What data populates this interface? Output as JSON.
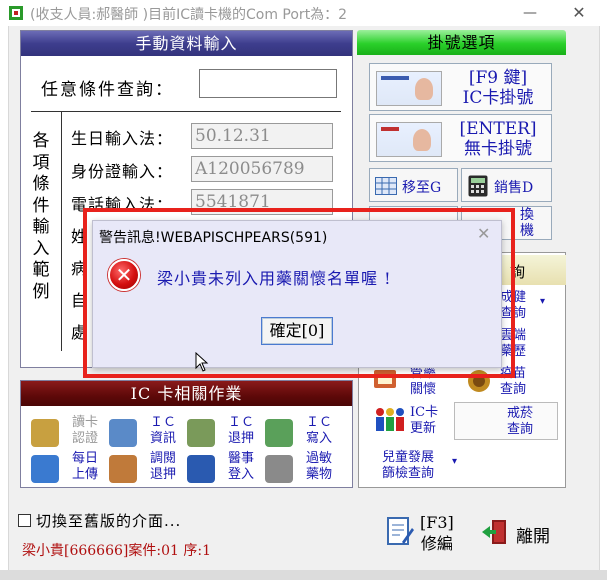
{
  "window": {
    "title": "(收支人員:郝醫師 )目前IC讀卡機的Com Port為：2",
    "minimize_glyph": "—",
    "close_glyph": "✕"
  },
  "manual": {
    "header": "手動資料輸入",
    "query_label": "任意條件查詢：",
    "query_value": "",
    "vertical_label": "各項條件輸入範例",
    "fields": [
      {
        "label": "生日輸入法：",
        "value": "50.12.31"
      },
      {
        "label": "身份證輸入：",
        "value": "A120056789"
      },
      {
        "label": "電話輸入法：",
        "value": "5541871"
      },
      {
        "label": "姓",
        "value": ""
      },
      {
        "label": "病",
        "value": ""
      },
      {
        "label": "自",
        "value": ""
      },
      {
        "label": "處",
        "value": ""
      }
    ]
  },
  "register": {
    "header": "掛號選項",
    "ic_button": {
      "line1": "[F9 鍵]",
      "line2": "IC卡掛號"
    },
    "enter_button": {
      "line1": "[ENTER]",
      "line2": "無卡掛號"
    },
    "goto_button": "移至G",
    "sales_button": "銷售D",
    "switch_line1": "換",
    "switch_line2": "機"
  },
  "query_panel": {
    "header": "詢",
    "items": [
      {
        "l1": "成健",
        "l2": "查詢"
      },
      {
        "l1": "雲端",
        "l2": "藥歷"
      },
      {
        "l1": "管藥",
        "l2": "關懷"
      },
      {
        "l1": "疫苗",
        "l2": "查詢"
      },
      {
        "l1": "IC卡",
        "l2": "更新"
      },
      {
        "l1": "戒菸",
        "l2": "查詢"
      },
      {
        "l1": "兒童發展",
        "l2": "篩檢查詢"
      }
    ]
  },
  "ic": {
    "header": "IC 卡相關作業",
    "items": [
      {
        "l1": "讀卡",
        "l2": "認證",
        "color": "#c8a040",
        "disabled": true
      },
      {
        "l1": "ＩＣ",
        "l2": "資訊",
        "color": "#5a8ac8",
        "disabled": false
      },
      {
        "l1": "ＩＣ",
        "l2": "退押",
        "color": "#7a9a5a",
        "disabled": false
      },
      {
        "l1": "ＩＣ",
        "l2": "寫入",
        "color": "#5aa05a",
        "disabled": false
      },
      {
        "l1": "每日",
        "l2": "上傳",
        "color": "#3a7ad0",
        "disabled": false
      },
      {
        "l1": "調閱",
        "l2": "退押",
        "color": "#c07a3a",
        "disabled": false
      },
      {
        "l1": "醫事",
        "l2": "登入",
        "color": "#2a5ab0",
        "disabled": false
      },
      {
        "l1": "過敏",
        "l2": "藥物",
        "color": "#8a8a8a",
        "disabled": false
      }
    ]
  },
  "bottom": {
    "old_ui_label": "切換至舊版的介面...",
    "patient_status": "梁小貴[666666]案件:01 序:1",
    "f3_line1": "[F3]",
    "f3_line2": "修編",
    "exit_label": "離開"
  },
  "dialog": {
    "title": "警告訊息!WEBAPISCHPEARS(591)",
    "close_glyph": "✕",
    "message": "梁小貴未列入用藥關懷名單喔 !",
    "ok_label": "確定[0]",
    "accent_frame_color": "#e8221c"
  }
}
